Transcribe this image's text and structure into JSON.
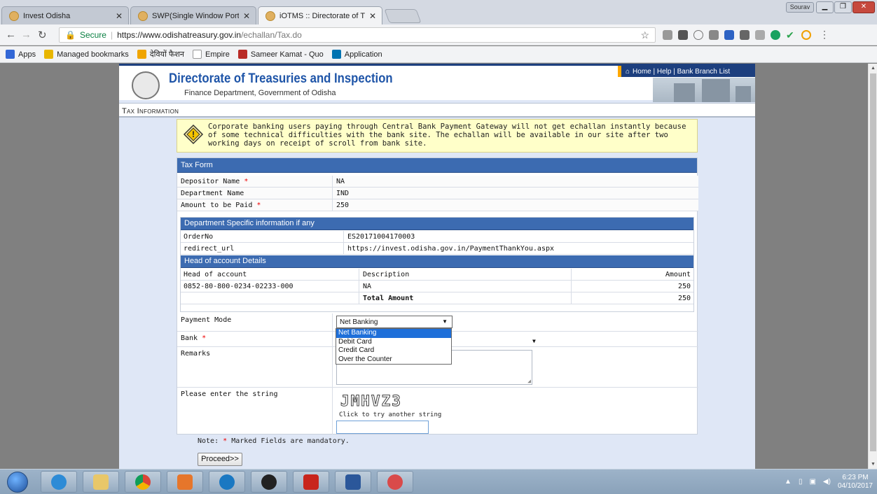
{
  "tabs": [
    {
      "title": "Invest Odisha"
    },
    {
      "title": "SWP(Single Window Port"
    },
    {
      "title": "iOTMS :: Directorate of T"
    }
  ],
  "profile_label": "Sourav",
  "omnibox": {
    "secure_label": "Secure",
    "host": "https://www.odishatreasury.gov.in",
    "path": "/echallan/Tax.do"
  },
  "bookmarks": [
    {
      "label": "Apps",
      "color": "#3367d6"
    },
    {
      "label": "Managed bookmarks",
      "color": "#e8b600"
    },
    {
      "label": "देवियों फैशन",
      "color": "#f0a500"
    },
    {
      "label": "Empire",
      "color": "#dddddd"
    },
    {
      "label": "Sameer Kamat - Quo",
      "color": "#b92b27"
    },
    {
      "label": "Application",
      "color": "#0073b1"
    }
  ],
  "header": {
    "title": "Directorate of Treasuries and Inspection",
    "subtitle": "Finance Department, Government of Odisha",
    "toplinks": "Home | Help | Bank Branch List"
  },
  "section_title": "Tax Information",
  "notice": "Corporate banking users paying through Central Bank Payment Gateway will not get echallan instantly because of some technical difficulties with the bank site. The echallan will be available in our site after two working days on receipt of scroll from bank site.",
  "form": {
    "heading": "Tax Form",
    "depositor_label": "Depositor Name",
    "depositor_value": "NA",
    "department_label": "Department Name",
    "department_value": "IND",
    "amount_label": "Amount to be Paid",
    "amount_value": "250",
    "dept_info_heading": "Department Specific information if any",
    "order_label": "OrderNo",
    "order_value": "ES20171004170003",
    "redirect_label": "redirect_url",
    "redirect_value": "https://invest.odisha.gov.in/PaymentThankYou.aspx",
    "hoa_heading": "Head of account Details",
    "hoa_cols": [
      "Head of account",
      "Description",
      "Amount"
    ],
    "hoa_row": [
      "0852-80-800-0234-02233-000",
      "NA",
      "250"
    ],
    "total_label": "Total Amount",
    "total_value": "250",
    "payment_mode_label": "Payment Mode",
    "payment_mode_value": "Net Banking",
    "payment_options": [
      "Net Banking",
      "Debit Card",
      "Credit Card",
      "Over the Counter"
    ],
    "bank_label": "Bank",
    "remarks_label": "Remarks",
    "captcha_label": "Please enter the string",
    "captcha_text": "JMHVZ3",
    "captcha_hint": "Click to try another string",
    "note_label": "Note:",
    "note_text": "Marked Fields are mandatory.",
    "required_mark": "*",
    "proceed_label": "Proceed>>"
  },
  "tray": {
    "time": "6:23 PM",
    "date": "04/10/2017"
  }
}
